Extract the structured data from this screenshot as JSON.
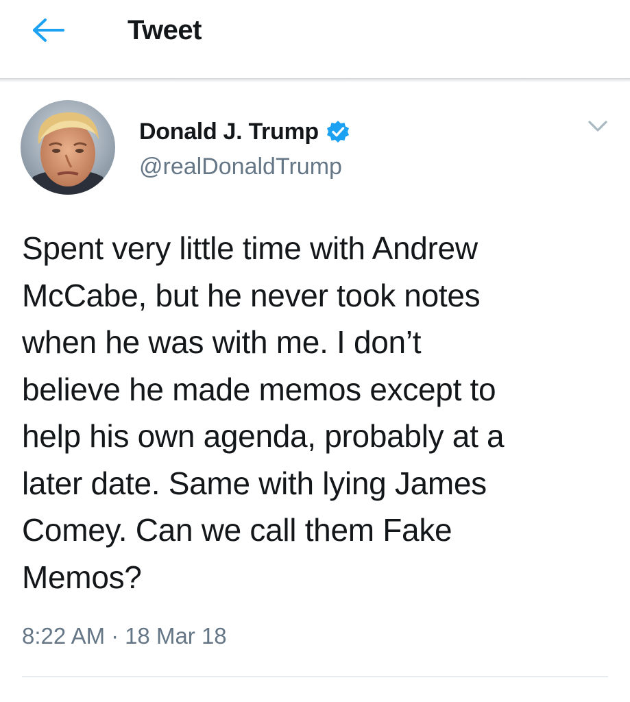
{
  "header": {
    "title": "Tweet",
    "back_icon": "back-arrow-icon",
    "accent_color": "#1da1f2"
  },
  "author": {
    "name": "Donald J. Trump",
    "handle": "@realDonaldTrump",
    "verified": true,
    "verified_icon": "verified-badge-icon",
    "avatar_icon": "avatar"
  },
  "menu": {
    "icon": "chevron-down-icon"
  },
  "tweet": {
    "text": "Spent very little time with Andrew\nMcCabe, but he never took notes\nwhen he was with me. I don’t\nbelieve he made memos except to\nhelp his own agenda, probably at a\nlater date. Same with lying James\nComey. Can we call them Fake\nMemos?",
    "time": "8:22 AM",
    "separator": "·",
    "date": "18 Mar 18"
  },
  "colors": {
    "text": "#14171a",
    "secondary": "#657786",
    "verified": "#1da1f2",
    "divider": "#e6ecf0"
  }
}
